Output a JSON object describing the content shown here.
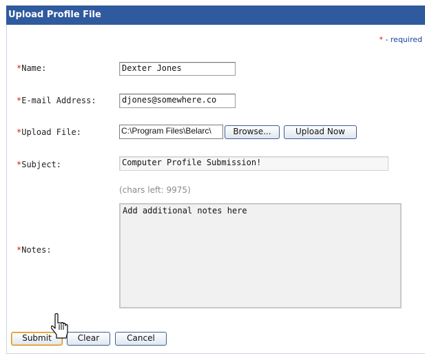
{
  "form": {
    "title": "Upload Profile File",
    "required_note": "- required",
    "required_marker": "*",
    "fields": {
      "name": {
        "label": "Name:",
        "value": "Dexter Jones"
      },
      "email": {
        "label": "E-mail Address:",
        "value": "djones@somewhere.co"
      },
      "upload": {
        "label": "Upload File:",
        "value": "C:\\Program Files\\Belarc\\",
        "browse_label": "Browse...",
        "upload_label": "Upload Now"
      },
      "subject": {
        "label": "Subject:",
        "value": "Computer Profile Submission!"
      },
      "notes": {
        "label": "Notes:",
        "chars_left": "(chars left: 9975)",
        "value": "Add additional notes here"
      }
    },
    "buttons": {
      "submit": "Submit",
      "clear": "Clear",
      "cancel": "Cancel"
    }
  },
  "colors": {
    "title_bar": "#2f5a9e",
    "required_star": "#d11a1a",
    "required_text": "#1a3f9e"
  }
}
